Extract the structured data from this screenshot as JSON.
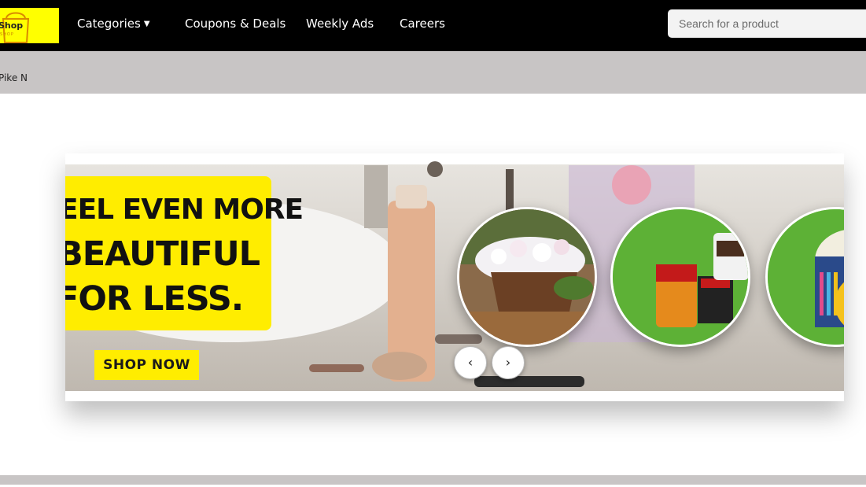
{
  "header": {
    "logo_text": "Shop",
    "logo_sub": "SHOP",
    "nav": {
      "categories": "Categories",
      "coupons": "Coupons & Deals",
      "weekly_ads": "Weekly Ads",
      "careers": "Careers"
    },
    "search_placeholder": "Search for a product"
  },
  "store": {
    "location_text": "Pike N"
  },
  "banner": {
    "line1": "EEL EVEN MORE",
    "line2": "BEAUTIFUL",
    "line3": "FOR LESS.",
    "cta": "SHOP NOW",
    "prev_label": "‹",
    "next_label": "›"
  },
  "colors": {
    "nav_bg": "#000000",
    "accent_yellow": "#ffed00",
    "store_bar": "#c8c5c5",
    "circle_green": "#5db136"
  }
}
